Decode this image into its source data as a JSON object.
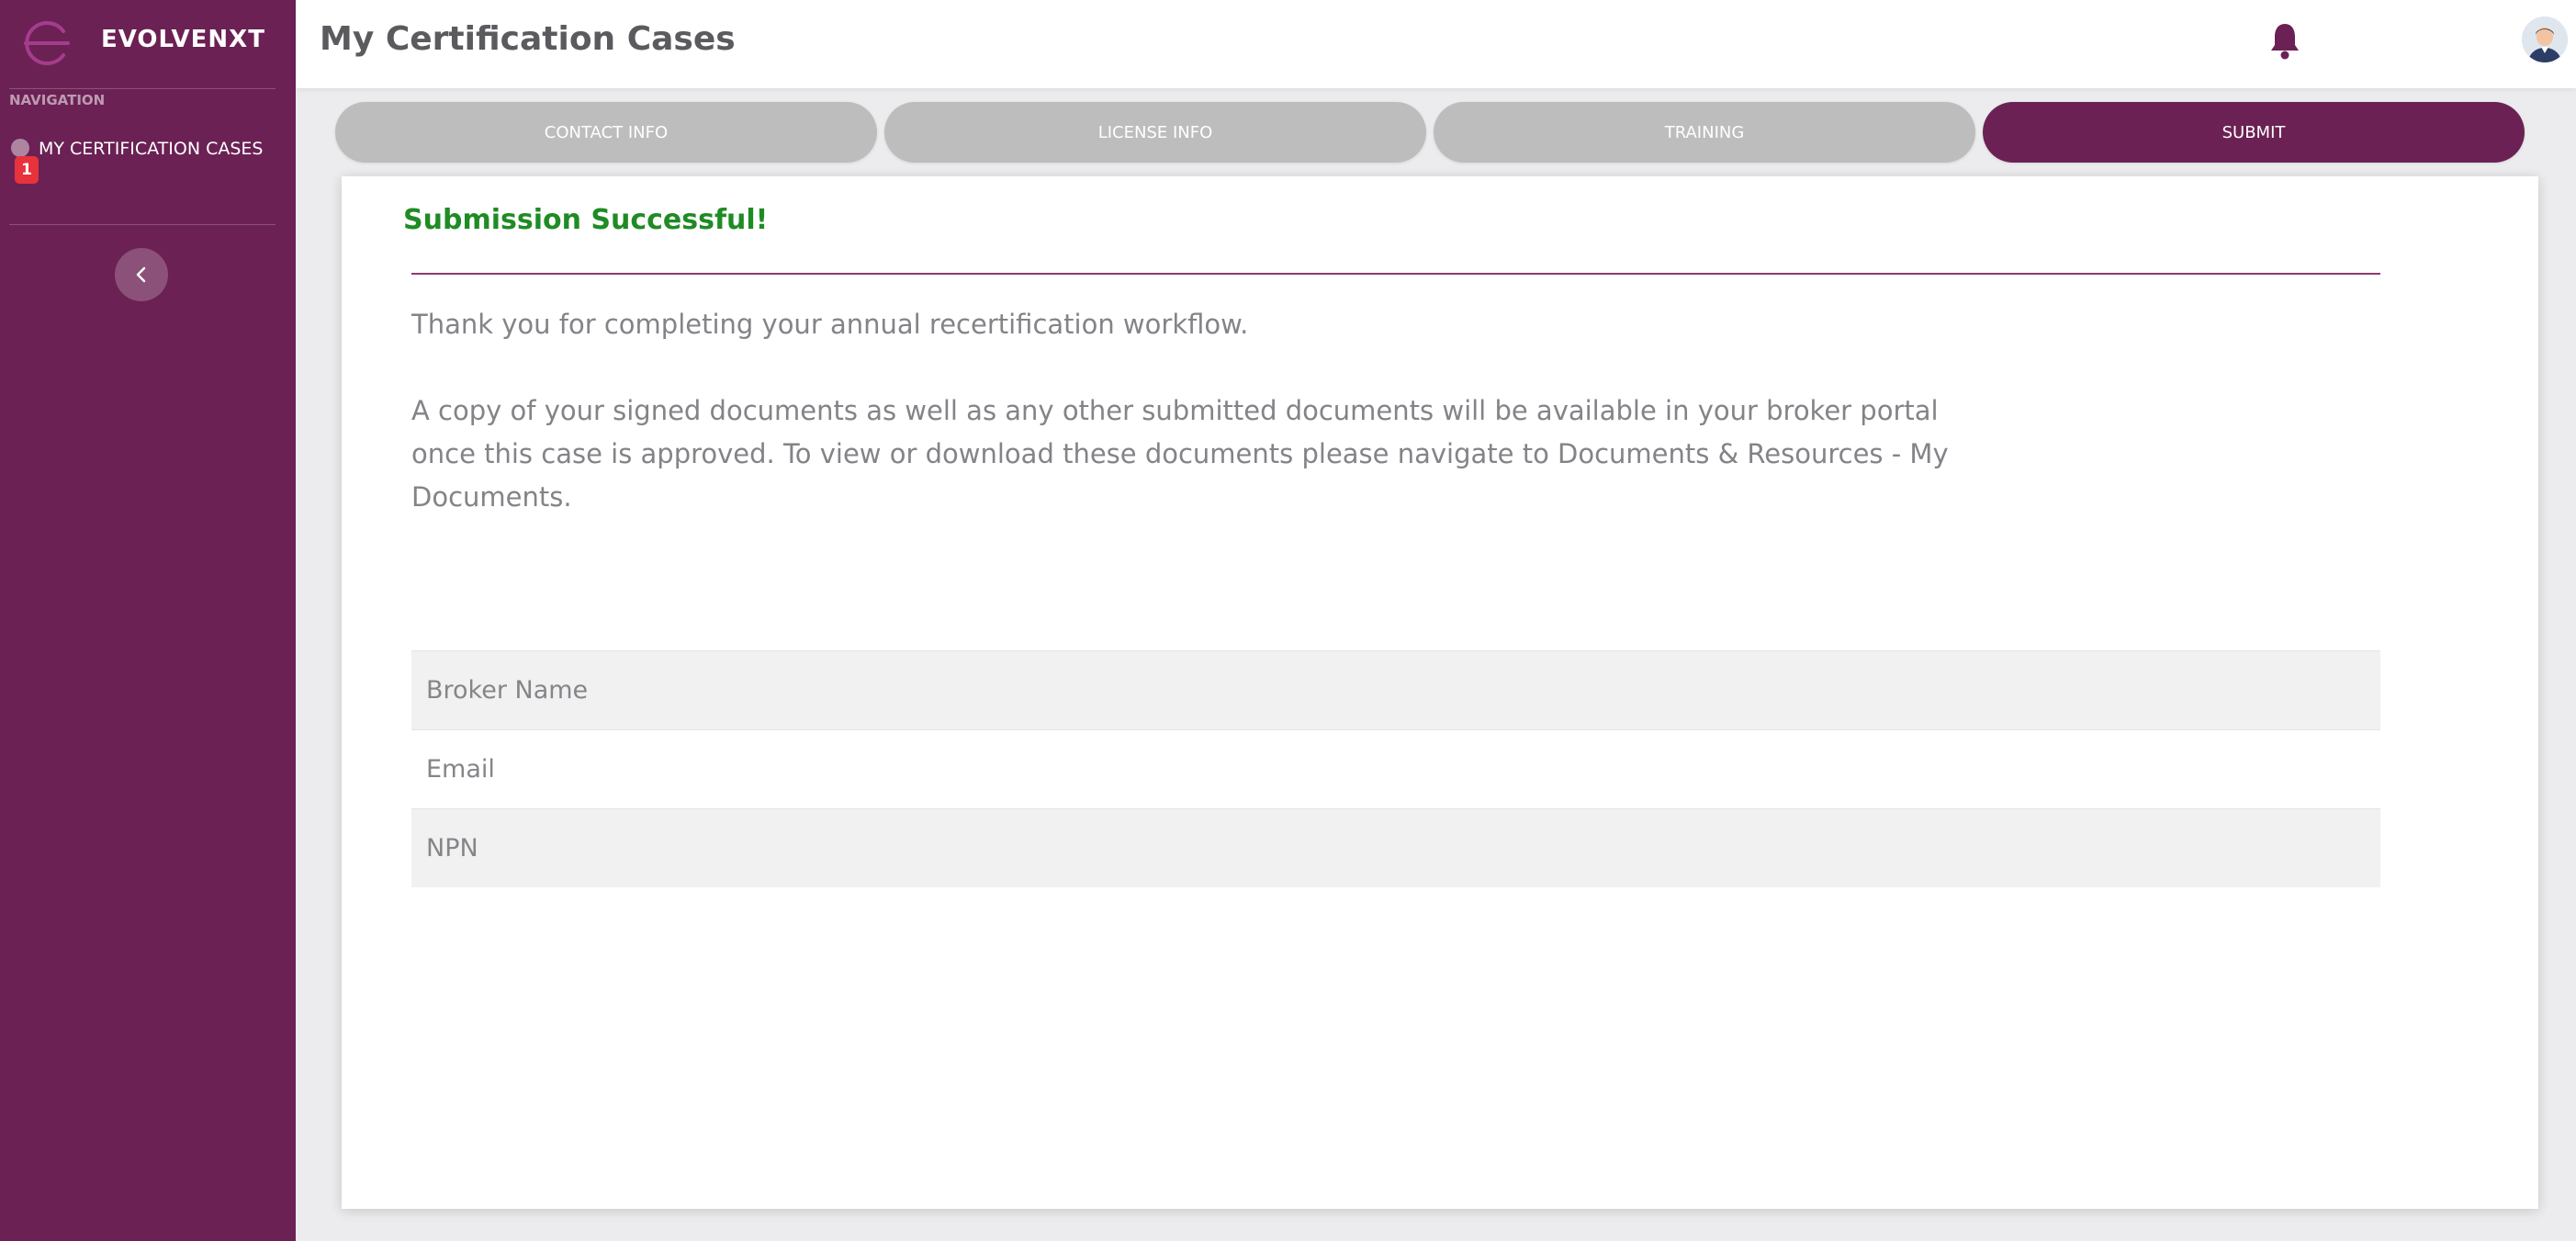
{
  "app": {
    "brand_name": "EVOLVENXT",
    "accent_color": "#6b2154",
    "success_color": "#1f8b24"
  },
  "sidebar": {
    "nav_heading": "NAVIGATION",
    "items": [
      {
        "label": "MY CERTIFICATION CASES",
        "badge": "1",
        "icon": "circle-dot-icon"
      }
    ],
    "collapse_icon": "chevron-left-icon"
  },
  "header": {
    "title": "My Certification Cases",
    "notification_icon": "bell-icon",
    "avatar_icon": "user-avatar"
  },
  "steps": [
    {
      "label": "CONTACT INFO",
      "active": false
    },
    {
      "label": "LICENSE INFO",
      "active": false
    },
    {
      "label": "TRAINING",
      "active": false
    },
    {
      "label": "SUBMIT",
      "active": true
    }
  ],
  "content": {
    "title": "Submission Successful!",
    "message_1": "Thank you for completing your annual recertification workflow.",
    "message_2": "A copy of your signed documents as well as any other submitted documents will be available in your broker portal once this case is approved. To view or download these documents please navigate to Documents & Resources - My Documents.",
    "info_rows": [
      {
        "label": "Broker Name"
      },
      {
        "label": "Email"
      },
      {
        "label": "NPN"
      }
    ]
  }
}
